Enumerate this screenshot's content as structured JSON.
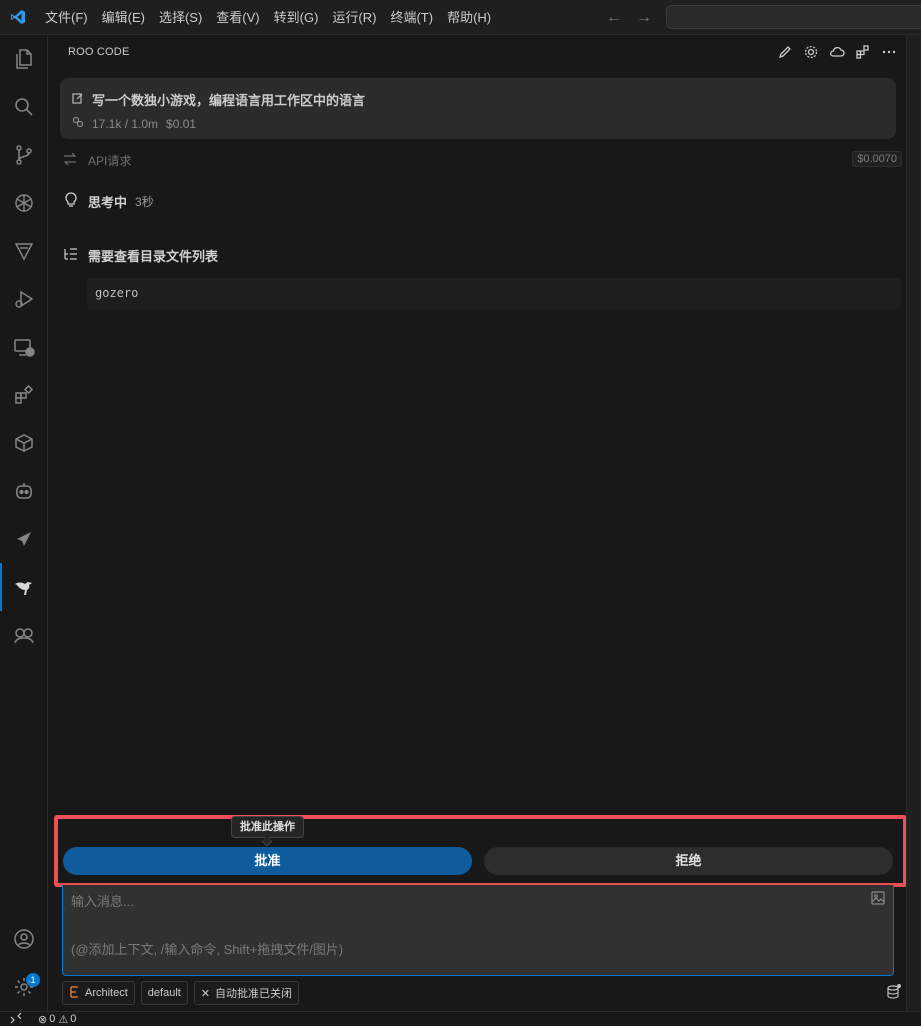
{
  "menu": [
    "文件(F)",
    "编辑(E)",
    "选择(S)",
    "查看(V)",
    "转到(G)",
    "运行(R)",
    "终端(T)",
    "帮助(H)"
  ],
  "panel": {
    "title": "ROO CODE"
  },
  "task": {
    "title": "写一个数独小游戏，编程语言用工作区中的语言",
    "tokens": "17.1k / 1.0m",
    "cost": "$0.01"
  },
  "api": {
    "label": "API请求",
    "cost": "$0.0070"
  },
  "thinking": {
    "label": "思考中",
    "time": "3秒"
  },
  "tool": {
    "label": "需要查看目录文件列表",
    "path": "gozero"
  },
  "actions": {
    "tooltip": "批准此操作",
    "approve": "批准",
    "reject": "拒绝"
  },
  "input": {
    "placeholder": "输入消息...",
    "hint": "(@添加上下文, /输入命令, Shift+拖拽文件/图片)"
  },
  "chips": {
    "mode": "Architect",
    "profile": "default",
    "auto_approve": "自动批准已关闭"
  },
  "activity": {
    "account_badge": "1"
  },
  "status": {
    "errors": "0",
    "warnings": "0"
  },
  "colors": {
    "accent": "#0078d4",
    "approve": "#0e5c9c",
    "highlight": "#ef4f55"
  }
}
